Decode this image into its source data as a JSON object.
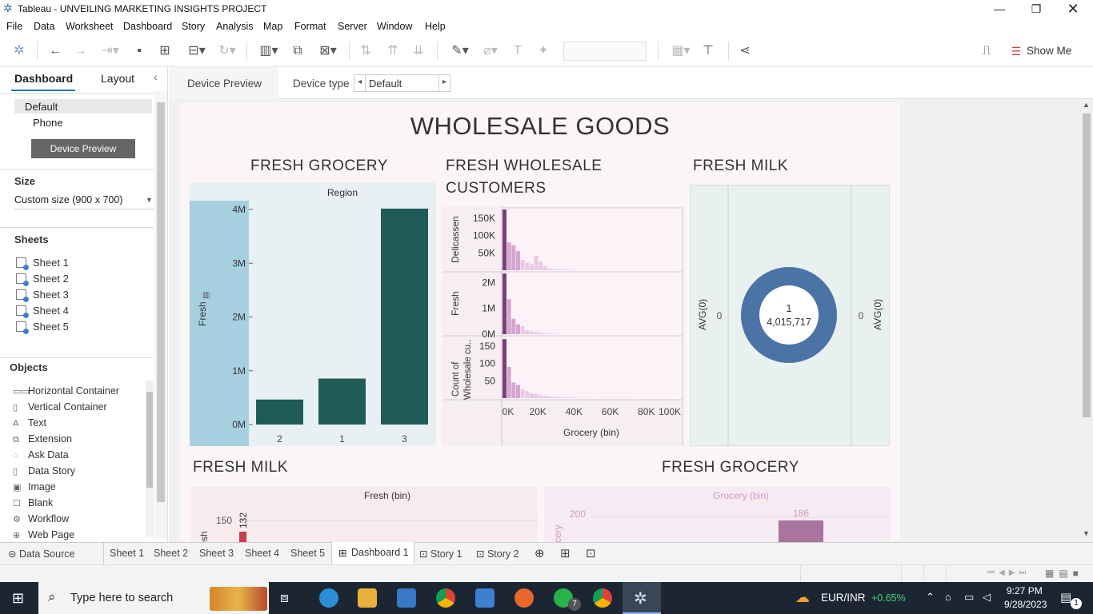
{
  "app": {
    "title": "Tableau - UNVEILING MARKETING INSIGHTS PROJECT"
  },
  "menu": [
    "File",
    "Data",
    "Worksheet",
    "Dashboard",
    "Story",
    "Analysis",
    "Map",
    "Format",
    "Server",
    "Window",
    "Help"
  ],
  "toolbar": {
    "show_me": "Show Me"
  },
  "left_pane": {
    "tab_dashboard": "Dashboard",
    "tab_layout": "Layout",
    "devices": [
      "Default",
      "Phone"
    ],
    "device_preview_button": "Device Preview",
    "size_heading": "Size",
    "size_value": "Custom size (900 x 700)",
    "sheets_heading": "Sheets",
    "sheets": [
      "Sheet 1",
      "Sheet 2",
      "Sheet 3",
      "Sheet 4",
      "Sheet 5"
    ],
    "objects_heading": "Objects",
    "objects": [
      {
        "label": "Horizontal Container",
        "icon": "horizontal-container-icon",
        "glyph": "▭▭"
      },
      {
        "label": "Vertical Container",
        "icon": "vertical-container-icon",
        "glyph": "▯"
      },
      {
        "label": "Text",
        "icon": "text-icon",
        "glyph": "A"
      },
      {
        "label": "Extension",
        "icon": "extension-icon",
        "glyph": "⧉"
      },
      {
        "label": "Ask Data",
        "icon": "ask-data-icon",
        "glyph": "◌"
      },
      {
        "label": "Data Story",
        "icon": "data-story-icon",
        "glyph": "▯"
      },
      {
        "label": "Image",
        "icon": "image-icon",
        "glyph": "▣"
      },
      {
        "label": "Blank",
        "icon": "blank-icon",
        "glyph": "☐"
      },
      {
        "label": "Workflow",
        "icon": "workflow-icon",
        "glyph": "⚙"
      },
      {
        "label": "Web Page",
        "icon": "web-page-icon",
        "glyph": "⊕"
      }
    ]
  },
  "dashbar": {
    "device_preview": "Device Preview",
    "device_type_label": "Device type",
    "device_type_value": "Default"
  },
  "dashboard": {
    "title": "WHOLESALE GOODS",
    "fresh_grocery": {
      "title": "FRESH GROCERY",
      "header": "Region",
      "ylabel": "Fresh",
      "yticks": [
        "4M",
        "3M",
        "2M",
        "1M",
        "0M"
      ]
    },
    "fresh_wholesale": {
      "title_line1": "FRESH WHOLESALE",
      "title_line2": "CUSTOMERS",
      "rows": [
        {
          "label": "Delicassen",
          "ticks": [
            "150K",
            "100K",
            "50K"
          ]
        },
        {
          "label": "Fresh",
          "ticks": [
            "2M",
            "1M",
            "0M"
          ]
        },
        {
          "label_line1": "Count of",
          "label_line2": "Wholesale cu..",
          "ticks": [
            "150",
            "100",
            "50"
          ]
        }
      ],
      "xticks": [
        "0K",
        "20K",
        "40K",
        "60K",
        "80K",
        "100K"
      ],
      "xlabel": "Grocery (bin)"
    },
    "fresh_milk_top": {
      "title": "FRESH MILK",
      "left_axis": "AVG(0)",
      "right_axis": "AVG(0)",
      "left_zero": "0",
      "right_zero": "0",
      "center_line1": "1",
      "center_line2": "4,015,717"
    },
    "fresh_milk_bottom": {
      "title": "FRESH MILK",
      "header": "Fresh (bin)",
      "ylabel": "Fresh",
      "ytick": "150",
      "bar_label": "132"
    },
    "fresh_grocery_bottom": {
      "title": "FRESH GROCERY",
      "header": "Grocery (bin)",
      "ylabel": "Grocery",
      "ytick": "200",
      "bar_label": "186"
    }
  },
  "chart_data": [
    {
      "type": "bar",
      "title": "FRESH GROCERY",
      "xlabel": "Region",
      "ylabel": "Fresh",
      "categories": [
        "2",
        "1",
        "3"
      ],
      "values": [
        464722,
        854833,
        4015717
      ],
      "ylim": [
        0,
        4000000
      ]
    },
    {
      "type": "bar",
      "title": "FRESH WHOLESALE CUSTOMERS",
      "xlabel": "Grocery (bin)",
      "ylabel": "Delicassen",
      "x": [
        0,
        2500,
        5000,
        7500,
        10000,
        12500,
        15000,
        17500,
        20000,
        22500,
        25000,
        27500,
        30000,
        32500,
        35000,
        37500,
        40000
      ],
      "values": [
        175000,
        80000,
        72000,
        55000,
        30000,
        22000,
        18000,
        42000,
        25000,
        12000,
        5000,
        3000,
        2500,
        2000,
        1500,
        1000,
        800
      ],
      "ylim": [
        0,
        175000
      ]
    },
    {
      "type": "bar",
      "title": "FRESH WHOLESALE CUSTOMERS",
      "xlabel": "Grocery (bin)",
      "ylabel": "Fresh",
      "x": [
        0,
        2500,
        5000,
        7500,
        10000,
        12500,
        15000,
        17500,
        20000,
        22500,
        25000,
        27500,
        30000
      ],
      "values": [
        2350000,
        1350000,
        600000,
        380000,
        300000,
        150000,
        110000,
        80000,
        55000,
        40000,
        25000,
        15000,
        10000
      ],
      "ylim": [
        0,
        2350000
      ]
    },
    {
      "type": "bar",
      "title": "FRESH WHOLESALE CUSTOMERS",
      "xlabel": "Grocery (bin)",
      "ylabel": "Count of Wholesale cu..",
      "x": [
        0,
        2500,
        5000,
        7500,
        10000,
        12500,
        15000,
        17500,
        20000,
        22500,
        25000,
        27500,
        30000,
        32500,
        35000,
        37500,
        40000,
        45000,
        55000,
        60000,
        65000,
        70000
      ],
      "values": [
        170,
        90,
        45,
        38,
        25,
        20,
        14,
        12,
        8,
        6,
        5,
        4,
        3,
        3,
        2,
        2,
        1,
        1,
        1,
        1,
        1,
        1
      ],
      "ylim": [
        0,
        175
      ]
    },
    {
      "type": "pie",
      "title": "FRESH MILK",
      "labels": [
        "1"
      ],
      "values": [
        4015717
      ]
    },
    {
      "type": "bar",
      "title": "FRESH MILK",
      "xlabel": "Fresh (bin)",
      "ylabel": "Fresh",
      "values": [
        132
      ],
      "data_labels": [
        "132"
      ]
    },
    {
      "type": "bar",
      "title": "FRESH GROCERY",
      "xlabel": "Grocery (bin)",
      "ylabel": "Grocery",
      "values": [
        186
      ],
      "data_labels": [
        "186"
      ]
    }
  ],
  "bottom_tabs": [
    "Data Source",
    "Sheet 1",
    "Sheet 2",
    "Sheet 3",
    "Sheet 4",
    "Sheet 5",
    "Dashboard 1",
    "Story 1",
    "Story 2"
  ],
  "taskbar": {
    "search_placeholder": "Type here to search",
    "whatsapp_badge": "7",
    "ticker": "EUR/INR",
    "ticker_change": "+0.65%",
    "time": "9:27 PM",
    "date": "9/28/2023",
    "notif_badge": "1"
  },
  "colors": {
    "teal_bar": "#1f5c58",
    "region_bg": "#a6d0e0",
    "plot_bg": "#e7f0f4",
    "pink_dark": "#7a3f78",
    "pink_mid": "#d6a5cf",
    "pink_light": "#ecc8e4",
    "donut": "#4b73a6",
    "milk_bar": "#c4404f",
    "grocery_bar": "#a9749e"
  }
}
